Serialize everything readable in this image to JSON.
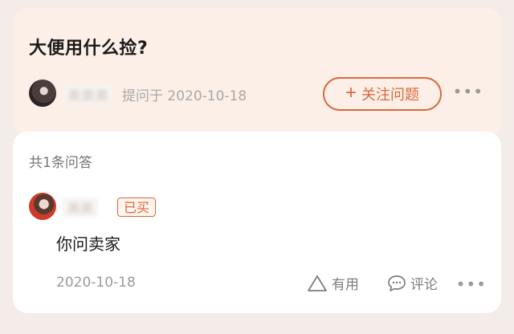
{
  "question": {
    "title": "大便用什么捡?",
    "asker_name": "美美美",
    "asked_time": "提问于 2020-10-18",
    "follow_label": "关注问题",
    "follow_icon": "plus-icon",
    "more_icon": "more-icon"
  },
  "answers": {
    "count_label": "共1条问答",
    "items": [
      {
        "user_name": "美美",
        "badge": "已买",
        "text": "你问卖家",
        "time": "2020-10-18",
        "useful_label": "有用",
        "comment_label": "评论"
      }
    ]
  },
  "colors": {
    "accent": "#d8693c",
    "question_bg": "#fcefe8",
    "card_bg": "#ffffff"
  }
}
